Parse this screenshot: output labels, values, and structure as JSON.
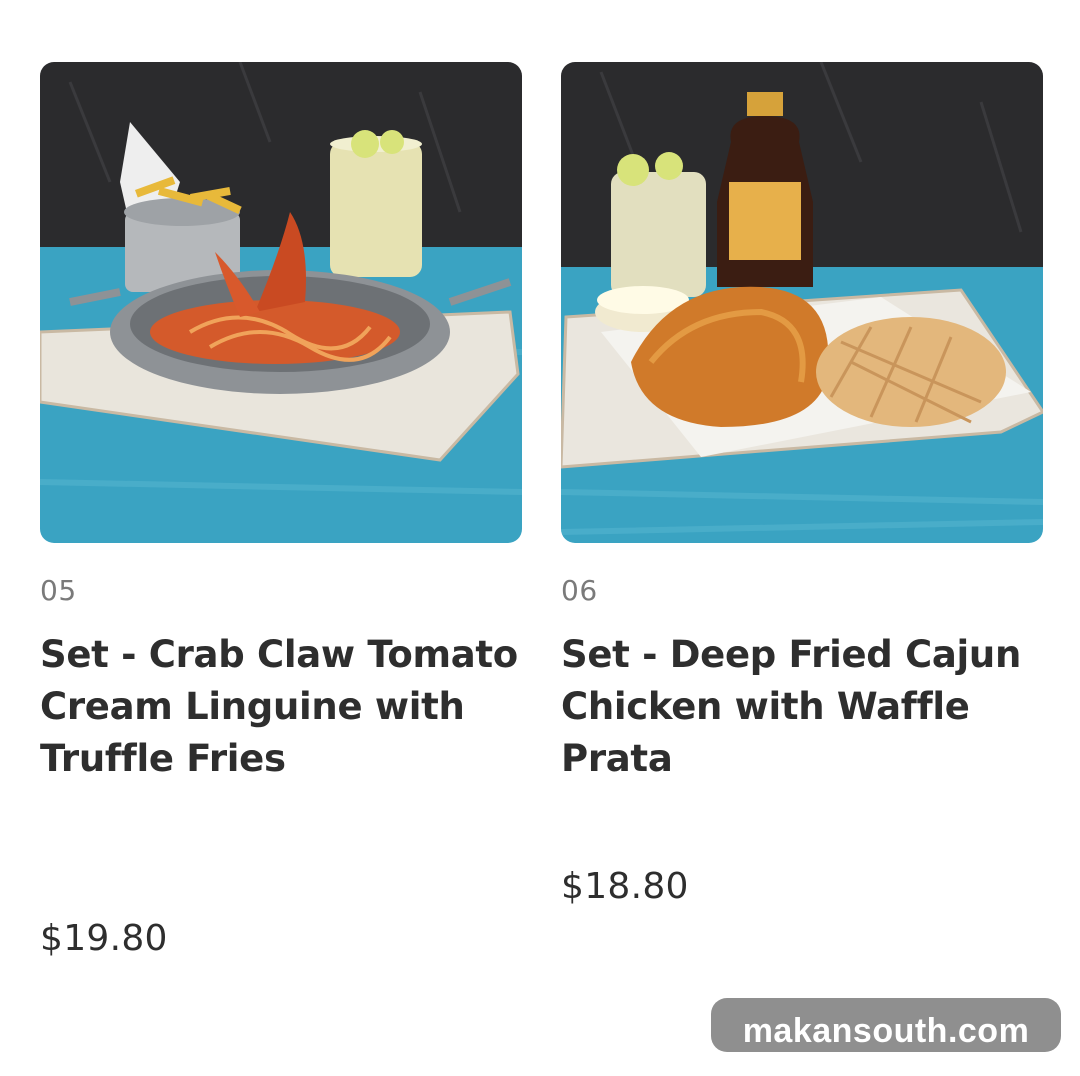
{
  "items": [
    {
      "number": "05",
      "title": "Set - Crab Claw Tomato Cream Linguine with Truffle Fries",
      "price": "$19.80",
      "image": "crab-claw-linguine-photo"
    },
    {
      "number": "06",
      "title": "Set - Deep Fried Cajun Chicken with Waffle Prata",
      "price": "$18.80",
      "image": "cajun-chicken-waffle-photo"
    }
  ],
  "watermark": "makansouth.com",
  "colors": {
    "text": "#2e2e2e",
    "muted": "#7a7a7a",
    "table": "#3aa3c2",
    "wall": "#2b2b2d",
    "watermark_bg": "#8f8f8f"
  }
}
